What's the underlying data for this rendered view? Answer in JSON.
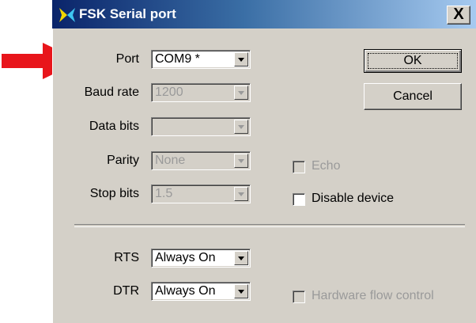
{
  "window": {
    "title": "FSK Serial port",
    "close_label": "X"
  },
  "fields": {
    "port": {
      "label": "Port",
      "value": "COM9 *"
    },
    "baud_rate": {
      "label": "Baud rate",
      "value": "1200"
    },
    "data_bits": {
      "label": "Data bits",
      "value": ""
    },
    "parity": {
      "label": "Parity",
      "value": "None"
    },
    "stop_bits": {
      "label": "Stop bits",
      "value": "1.5"
    },
    "rts": {
      "label": "RTS",
      "value": "Always On"
    },
    "dtr": {
      "label": "DTR",
      "value": "Always On"
    }
  },
  "buttons": {
    "ok": "OK",
    "cancel": "Cancel"
  },
  "checkboxes": {
    "echo": {
      "label": "Echo",
      "checked": false,
      "enabled": false
    },
    "disable_device": {
      "label": "Disable device",
      "checked": false,
      "enabled": true
    },
    "hardware_flow_control": {
      "label": "Hardware flow control",
      "checked": false,
      "enabled": false
    }
  },
  "annotation": {
    "arrow_color": "#e8151b"
  },
  "icons": {
    "app_icon": "butterfly-icon",
    "pointer": "red-arrow-icon"
  }
}
